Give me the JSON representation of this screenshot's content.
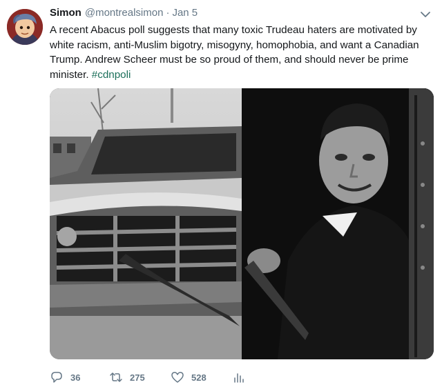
{
  "tweet": {
    "author_name": "Simon",
    "author_handle": "@montrealsimon",
    "separator": "·",
    "date": "Jan 5",
    "text_main": "A recent Abacus poll suggests that many toxic Trudeau haters are motivated by white racism, anti-Muslim bigotry, misogyny, homophobia, and want a Canadian Trump. Andrew Scheer must be so proud of them, and should never be prime minister.",
    "hashtag": "#cdnpoli"
  },
  "actions": {
    "replies": "36",
    "retweets": "275",
    "likes": "528"
  },
  "icons": {
    "reply": "reply-icon",
    "retweet": "retweet-icon",
    "like": "heart-icon",
    "analytics": "analytics-icon",
    "menu": "chevron-down-icon"
  },
  "colors": {
    "hashtag": "#1b6f5a",
    "secondary_text": "#657786"
  }
}
